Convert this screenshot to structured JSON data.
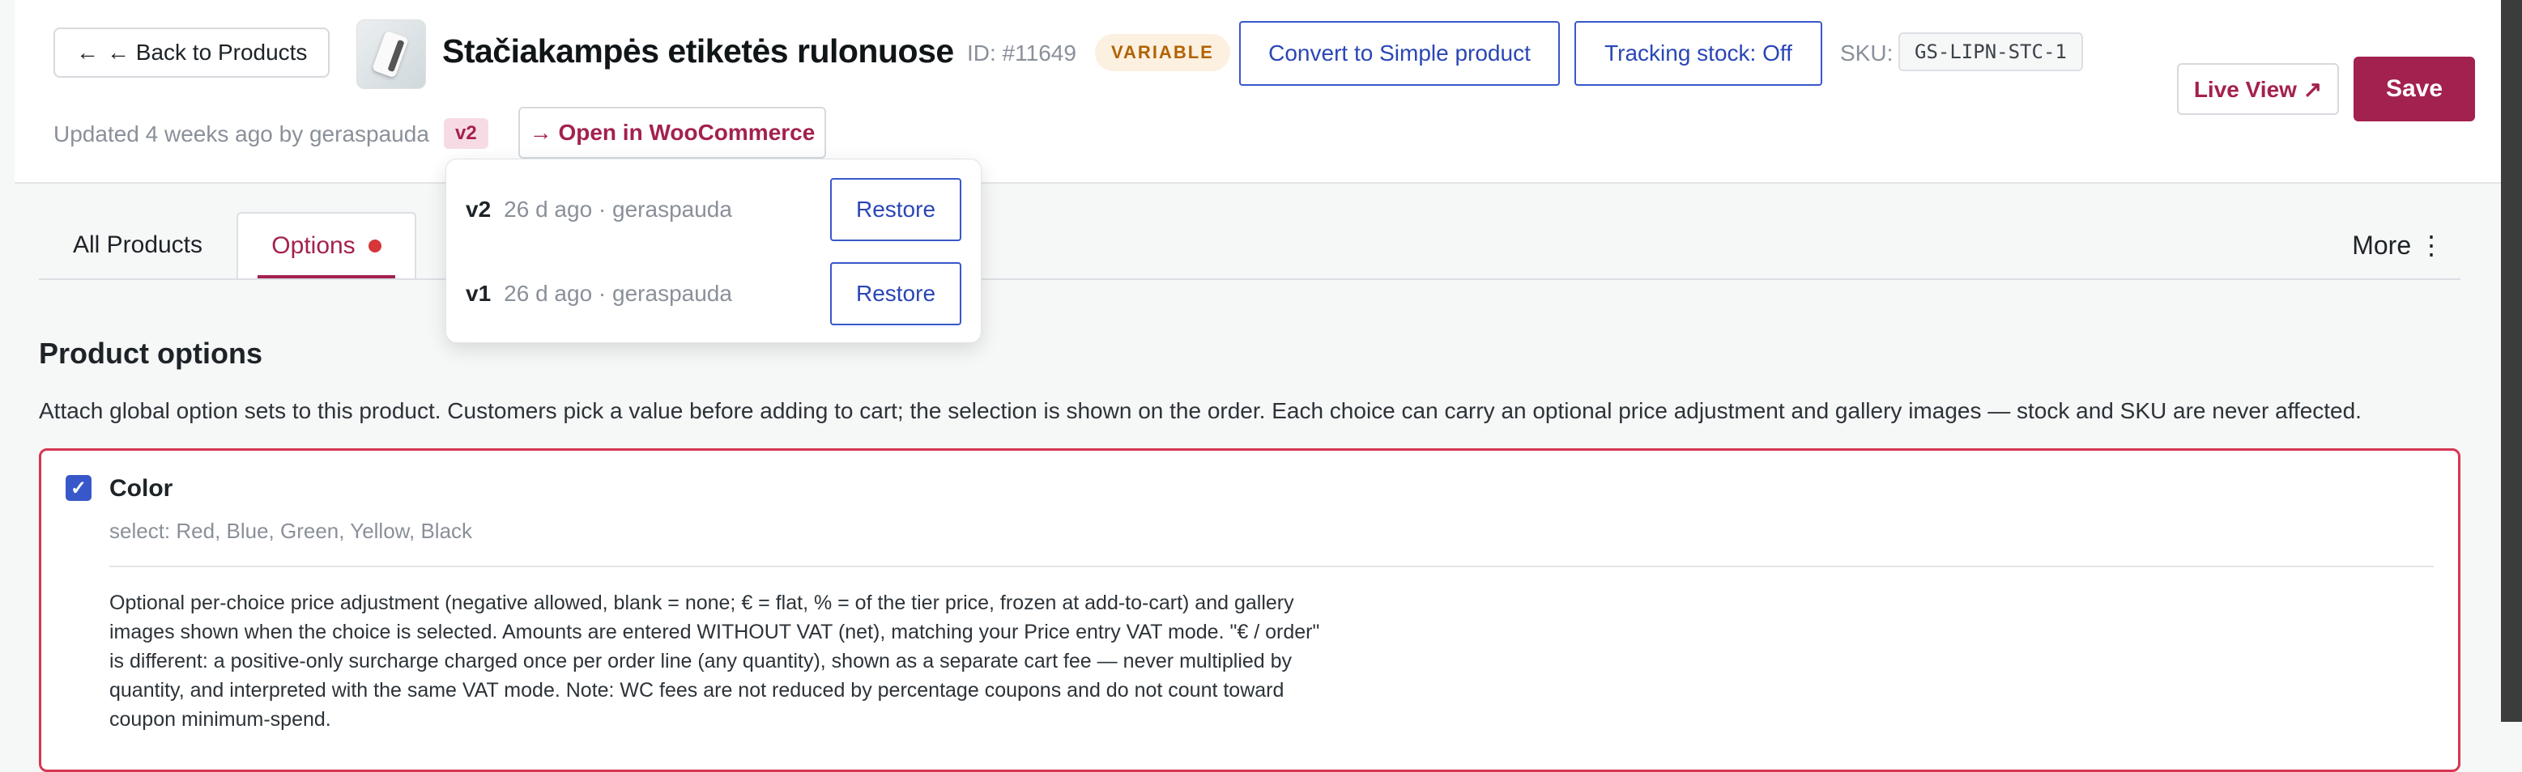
{
  "header": {
    "back_label": "← Back to Products",
    "product_title": "Stačiakampės etiketės rulonuose",
    "product_id": "ID: #11649",
    "type_badge": "VARIABLE",
    "convert_label": "Convert to Simple product",
    "tracking_label": "Tracking stock: Off",
    "sku_label": "SKU:",
    "sku_value": "GS-LIPN-STC-1",
    "live_view_label": "Live View ↗",
    "save_label": "Save",
    "updated_text": "Updated 4 weeks ago by geraspauda",
    "version_badge": "v2",
    "woocommerce_label": "→ Open in WooCommerce"
  },
  "tabs": {
    "all_products": "All Products",
    "options": "Options",
    "more": "More ⋮"
  },
  "versions": [
    {
      "name": "v2",
      "meta": "26 d ago · geraspauda",
      "action": "Restore"
    },
    {
      "name": "v1",
      "meta": "26 d ago · geraspauda",
      "action": "Restore"
    }
  ],
  "main": {
    "section_title": "Product options",
    "section_desc": "Attach global option sets to this product. Customers pick a value before adding to cart; the selection is shown on the order. Each choice can carry an optional price adjustment and gallery images — stock and SKU are never affected.",
    "option": {
      "checked": true,
      "name": "Color",
      "values": "select: Red, Blue, Green, Yellow, Black",
      "help": "Optional per-choice price adjustment (negative allowed, blank = none; € = flat, % = of the tier price, frozen at add-to-cart) and gallery images shown when the choice is selected. Amounts are entered WITHOUT VAT (net), matching your Price entry VAT mode. \"€ / order\" is different: a positive-only surcharge charged once per order line (any quantity), shown as a separate cart fee — never multiplied by quantity, and interpreted with the same VAT mode. Note: WC fees are not reduced by percentage coupons and do not count toward coupon minimum-spend."
    }
  },
  "colors": {
    "brand": "#a3214f",
    "accent_blue": "#3858c9",
    "error_border": "#d63652"
  }
}
